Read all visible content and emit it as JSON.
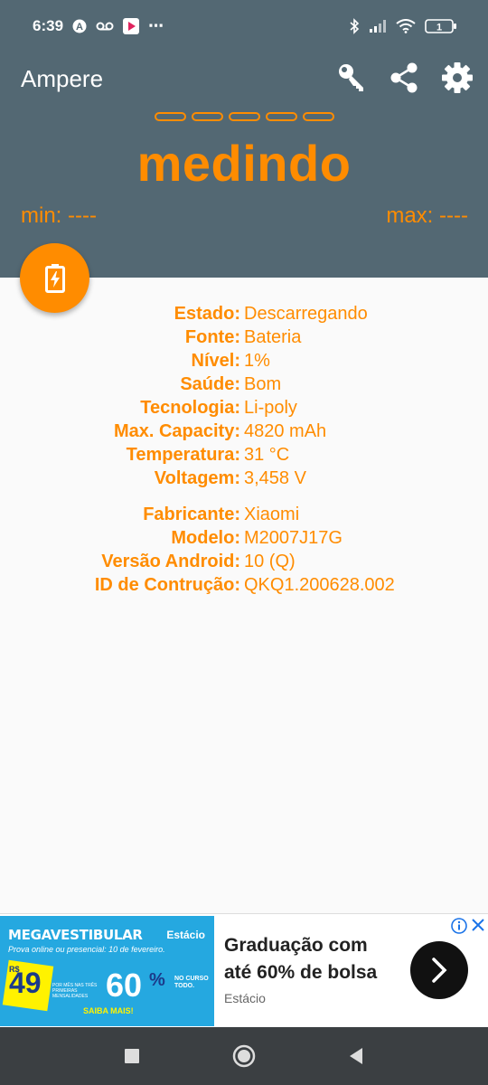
{
  "status_bar": {
    "time": "6:39",
    "more": "⋯",
    "left_icons": [
      "a-circle-icon",
      "voicemail-icon",
      "play-icon"
    ],
    "right_icons": [
      "bluetooth-icon",
      "signal-icon",
      "wifi-icon",
      "battery-icon"
    ],
    "battery_level": "1"
  },
  "header": {
    "title": "Ampere",
    "actions": [
      "key-icon",
      "share-icon",
      "settings-icon"
    ],
    "status": "medindo",
    "min_label": "min: ----",
    "max_label": "max: ----"
  },
  "battery_info": [
    {
      "key": "Estado:",
      "value": "Descarregando"
    },
    {
      "key": "Fonte:",
      "value": "Bateria"
    },
    {
      "key": "Nível:",
      "value": "1%"
    },
    {
      "key": "Saúde:",
      "value": "Bom"
    },
    {
      "key": "Tecnologia:",
      "value": "Li-poly"
    },
    {
      "key": "Max. Capacity:",
      "value": "4820 mAh"
    },
    {
      "key": "Temperatura:",
      "value": "31 °C"
    },
    {
      "key": "Voltagem:",
      "value": "3,458 V"
    }
  ],
  "device_info": [
    {
      "key": "Fabricante:",
      "value": "Xiaomi"
    },
    {
      "key": "Modelo:",
      "value": "M2007J17G"
    },
    {
      "key": "Versão Android:",
      "value": "10 (Q)"
    },
    {
      "key": "ID de Contrução:",
      "value": "QKQ1.200628.002"
    }
  ],
  "ad": {
    "banner_brand": "MEGAVESTIBULAR",
    "banner_logo": "Estácio",
    "banner_sub": "Prova online ou presencial: 10 de fevereiro.",
    "banner_rs": "R$",
    "banner_price": "49",
    "banner_price_note": "POR MÊS NAS TRÊS PRIMEIRAS MENSALIDADES",
    "banner_pct": "60",
    "banner_pct_sign": "%",
    "banner_curso": "NO CURSO TODO.",
    "banner_cta": "SAIBA MAIS!",
    "headline": "Graduação com até 60% de bolsa",
    "source": "Estácio",
    "accent": "#1a73e8"
  },
  "colors": {
    "header_bg": "#536873",
    "accent": "#ff8c00",
    "nav_bg": "#3b3f42"
  }
}
